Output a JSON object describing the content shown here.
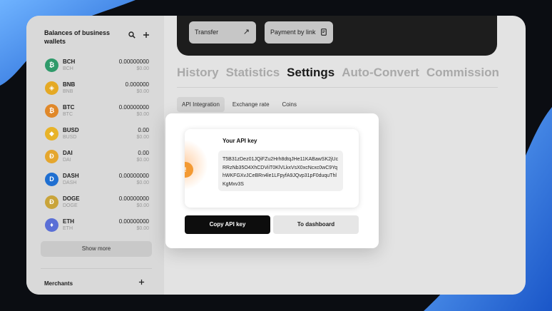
{
  "sidebar": {
    "title": "Balances of business wallets",
    "search_icon": "search-icon",
    "add_icon": "plus-icon",
    "coins": [
      {
        "symbol": "BCH",
        "sub": "BCH",
        "amount": "0.00000000",
        "usd": "$0.00",
        "color": "#2f9a6a",
        "glyph": "₿"
      },
      {
        "symbol": "BNB",
        "sub": "BNB",
        "amount": "0.000000",
        "usd": "$0.00",
        "color": "#e5a924",
        "glyph": "◈"
      },
      {
        "symbol": "BTC",
        "sub": "BTC",
        "amount": "0.00000000",
        "usd": "$0.00",
        "color": "#e0882a",
        "glyph": "₿"
      },
      {
        "symbol": "BUSD",
        "sub": "BUSD",
        "amount": "0.00",
        "usd": "$0.00",
        "color": "#e8b328",
        "glyph": "◆"
      },
      {
        "symbol": "DAI",
        "sub": "DAI",
        "amount": "0.00",
        "usd": "$0.00",
        "color": "#e5a62d",
        "glyph": "Đ"
      },
      {
        "symbol": "DASH",
        "sub": "DASH",
        "amount": "0.00000000",
        "usd": "$0.00",
        "color": "#1f6fd1",
        "glyph": "D"
      },
      {
        "symbol": "DOGE",
        "sub": "DOGE",
        "amount": "0.00000000",
        "usd": "$0.00",
        "color": "#c9a43a",
        "glyph": "Ð"
      },
      {
        "symbol": "ETH",
        "sub": "ETH",
        "amount": "0.00000000",
        "usd": "$0.00",
        "color": "#5a6fd6",
        "glyph": "♦"
      }
    ],
    "show_more": "Show more",
    "merchants": "Merchants"
  },
  "topbar": {
    "transfer": "Transfer",
    "payment_by_link": "Payment by link"
  },
  "tabs": [
    "History",
    "Statistics",
    "Settings",
    "Auto-Convert",
    "Commission"
  ],
  "active_tab": "Settings",
  "subtabs": [
    "API Integration",
    "Exchange rate",
    "Coins"
  ],
  "modal": {
    "title": "Your API key",
    "warning": "!",
    "api_key": "T5B31zDez01JQiFZu2Hrh8dtqJHe11KABawSK2jUcRRzNb35O4XhCDViiT0KlVLkxVsX0xcNcxc0wC9YqhWKFGXvJCeBRn4le1LFpyfA9JQvp31pF0duquThlKgMxv3S",
    "copy_button": "Copy API key",
    "dashboard_button": "To dashboard"
  },
  "colors": {
    "accent": "#f39a33",
    "background_blue": "#2f7de0"
  }
}
